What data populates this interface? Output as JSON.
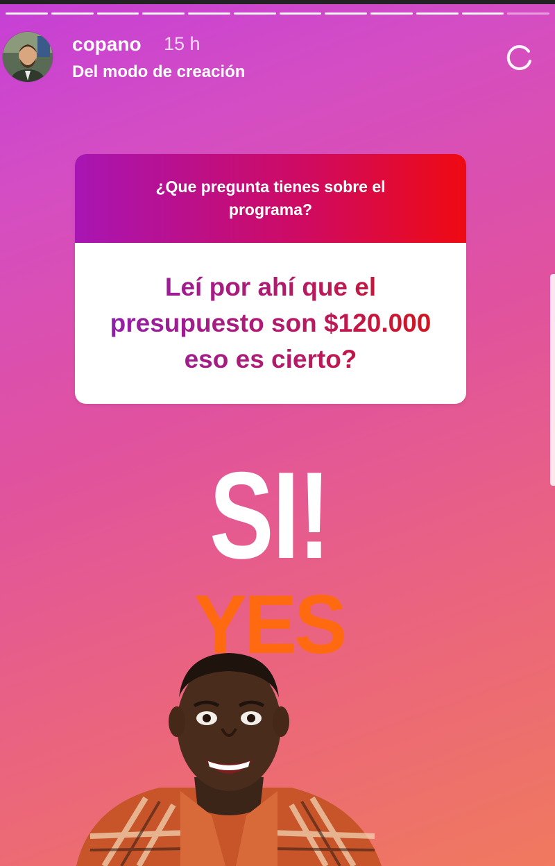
{
  "story": {
    "username": "copano",
    "timestamp": "15 h",
    "subtitle": "Del modo de creación",
    "progress_segments": 12,
    "progress_completed": 11
  },
  "question_sticker": {
    "prompt": "¿Que pregunta tienes sobre el programa?",
    "answer": "Leí por ahí que el presupuesto son $120.000 eso es cierto?"
  },
  "stickers": {
    "si_text": "SI!",
    "yes_text": "YES"
  },
  "icons": {
    "avatar": "avatar",
    "loading": "loading-spinner-icon"
  },
  "colors": {
    "question_header_start": "#a815b3",
    "question_header_end": "#ef0a12",
    "yes_color": "#ff6a10"
  }
}
